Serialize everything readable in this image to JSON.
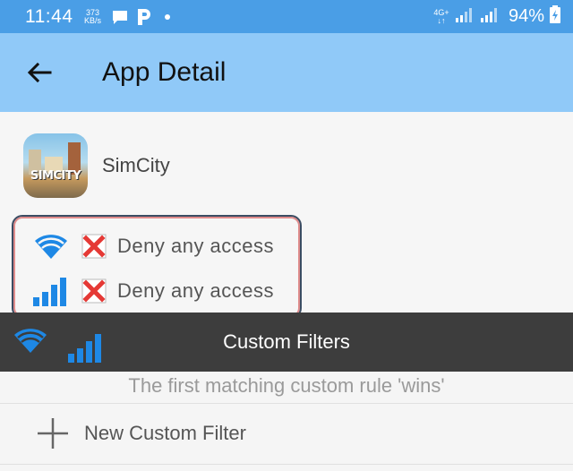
{
  "status_bar": {
    "time": "11:44",
    "speed_value": "373",
    "speed_unit": "KB/s",
    "network_type": "4G+",
    "network_arrows": "↓↑",
    "battery": "94%"
  },
  "app_bar": {
    "title": "App Detail"
  },
  "app": {
    "name": "SimCity",
    "icon_text": "SIMCITY"
  },
  "rules": [
    {
      "connection": "wifi-icon",
      "action": "Deny any access"
    },
    {
      "connection": "cellular-icon",
      "action": "Deny any access"
    }
  ],
  "filters": {
    "title": "Custom Filters",
    "hint": "The first matching custom rule 'wins'",
    "new_filter_label": "New Custom Filter"
  },
  "colors": {
    "status_bar": "#4a9ee6",
    "app_bar": "#90c9f8",
    "accent_blue": "#1e88e5",
    "deny_red": "#e53935",
    "filters_bar": "#3d3d3d"
  }
}
